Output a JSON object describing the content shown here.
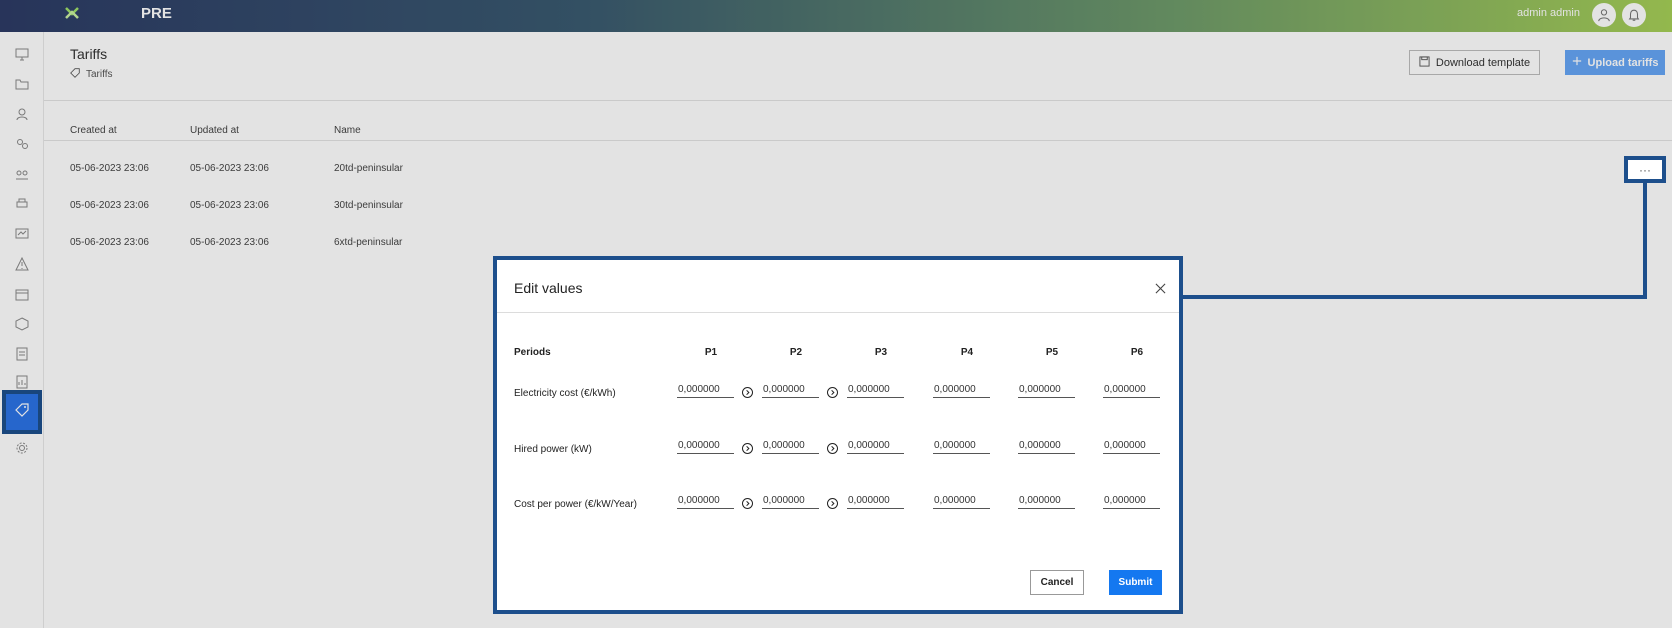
{
  "topbar": {
    "app_name": "PRE",
    "user_name": "admin admin",
    "icons": [
      "logo-icon",
      "user-icon",
      "bell-icon"
    ]
  },
  "sidebar": {
    "icons": [
      "monitor-icon",
      "folder-icon",
      "user-pin-icon",
      "users-gear-icon",
      "group-icon",
      "printer-icon",
      "dashboard-icon",
      "warning-icon",
      "calendar-icon",
      "box-icon",
      "document-icon",
      "chart-doc-icon",
      "tag-icon",
      "gear-icon"
    ],
    "active_item": "tag-icon"
  },
  "page": {
    "title": "Tariffs",
    "breadcrumb": "Tariffs",
    "download_label": "Download template",
    "upload_label": "Upload tariffs"
  },
  "table": {
    "headers": [
      "Created at",
      "Updated at",
      "Name"
    ],
    "rows": [
      {
        "created": "05-06-2023 23:06",
        "updated": "05-06-2023 23:06",
        "name": "20td-peninsular"
      },
      {
        "created": "05-06-2023 23:06",
        "updated": "05-06-2023 23:06",
        "name": "30td-peninsular"
      },
      {
        "created": "05-06-2023 23:06",
        "updated": "05-06-2023 23:06",
        "name": "6xtd-peninsular"
      }
    ],
    "row_menu_label": "···"
  },
  "modal": {
    "title": "Edit values",
    "periods_label": "Periods",
    "columns": [
      "P1",
      "P2",
      "P3",
      "P4",
      "P5",
      "P6"
    ],
    "rows": [
      {
        "label": "Electricity cost (€/kWh)",
        "values": [
          "0,000000",
          "0,000000",
          "0,000000",
          "0,000000",
          "0,000000",
          "0,000000"
        ]
      },
      {
        "label": "Hired power (kW)",
        "values": [
          "0,000000",
          "0,000000",
          "0,000000",
          "0,000000",
          "0,000000",
          "0,000000"
        ]
      },
      {
        "label": "Cost per power (€/kW/Year)",
        "values": [
          "0,000000",
          "0,000000",
          "0,000000",
          "0,000000",
          "0,000000",
          "0,000000"
        ]
      }
    ],
    "cancel_label": "Cancel",
    "submit_label": "Submit"
  },
  "colors": {
    "accent": "#1478f0",
    "highlight": "#1d4f8c"
  }
}
